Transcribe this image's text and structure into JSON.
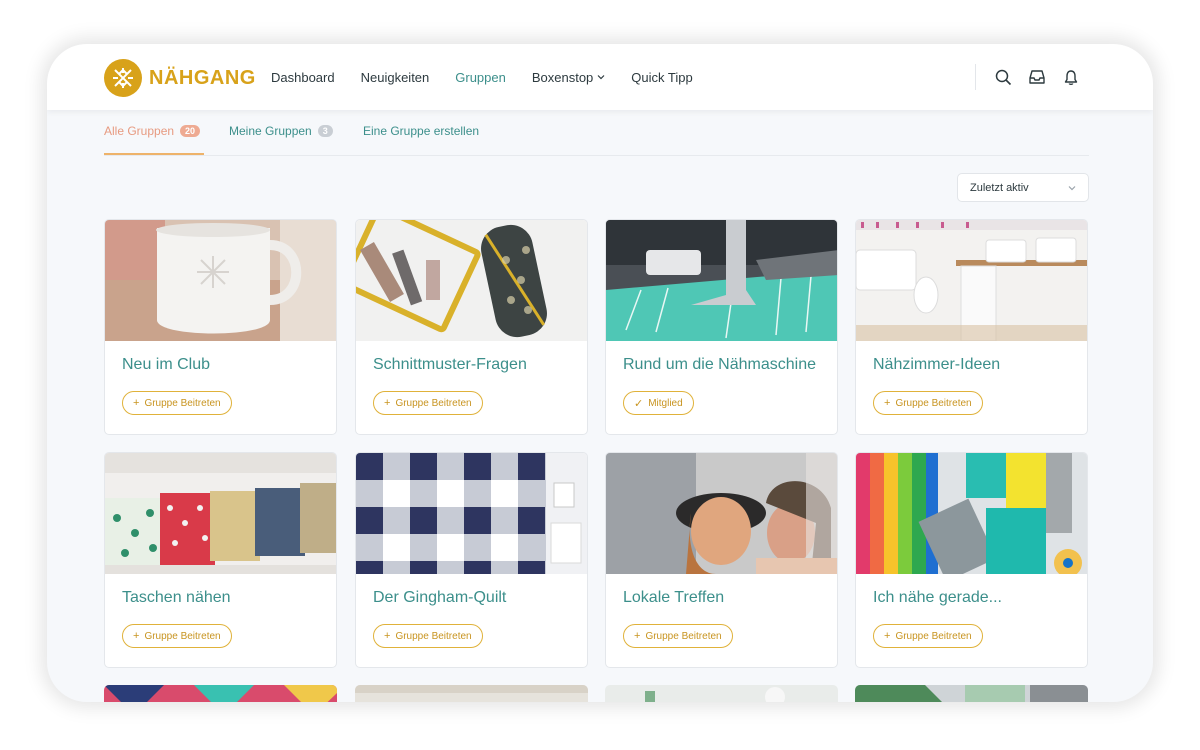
{
  "brand": {
    "name": "NÄHGANG",
    "color": "#d8a21a",
    "accent": "#3c8f8b"
  },
  "nav": {
    "items": [
      {
        "label": "Dashboard",
        "active": false
      },
      {
        "label": "Neuigkeiten",
        "active": false
      },
      {
        "label": "Gruppen",
        "active": true
      },
      {
        "label": "Boxenstop",
        "active": false,
        "dropdown": true
      },
      {
        "label": "Quick Tipp",
        "active": false
      }
    ],
    "icons": [
      "search-icon",
      "inbox-icon",
      "bell-icon"
    ]
  },
  "tabs": [
    {
      "label": "Alle Gruppen",
      "count": "20",
      "active": true
    },
    {
      "label": "Meine Gruppen",
      "count": "3",
      "active": false
    },
    {
      "label": "Eine Gruppe erstellen",
      "active": false
    }
  ],
  "sort": {
    "value": "Zuletzt aktiv"
  },
  "groups": [
    {
      "title": "Neu im Club",
      "action": "Gruppe Beitreten",
      "action_icon": "plus"
    },
    {
      "title": "Schnittmuster-Fragen",
      "action": "Gruppe Beitreten",
      "action_icon": "plus"
    },
    {
      "title": "Rund um die Nähmaschine",
      "action": "Mitglied",
      "action_icon": "check"
    },
    {
      "title": "Nähzimmer-Ideen",
      "action": "Gruppe Beitreten",
      "action_icon": "plus"
    },
    {
      "title": "Taschen nähen",
      "action": "Gruppe Beitreten",
      "action_icon": "plus"
    },
    {
      "title": "Der Gingham-Quilt",
      "action": "Gruppe Beitreten",
      "action_icon": "plus"
    },
    {
      "title": "Lokale Treffen",
      "action": "Gruppe Beitreten",
      "action_icon": "plus"
    },
    {
      "title": "Ich nähe gerade...",
      "action": "Gruppe Beitreten",
      "action_icon": "plus"
    }
  ]
}
